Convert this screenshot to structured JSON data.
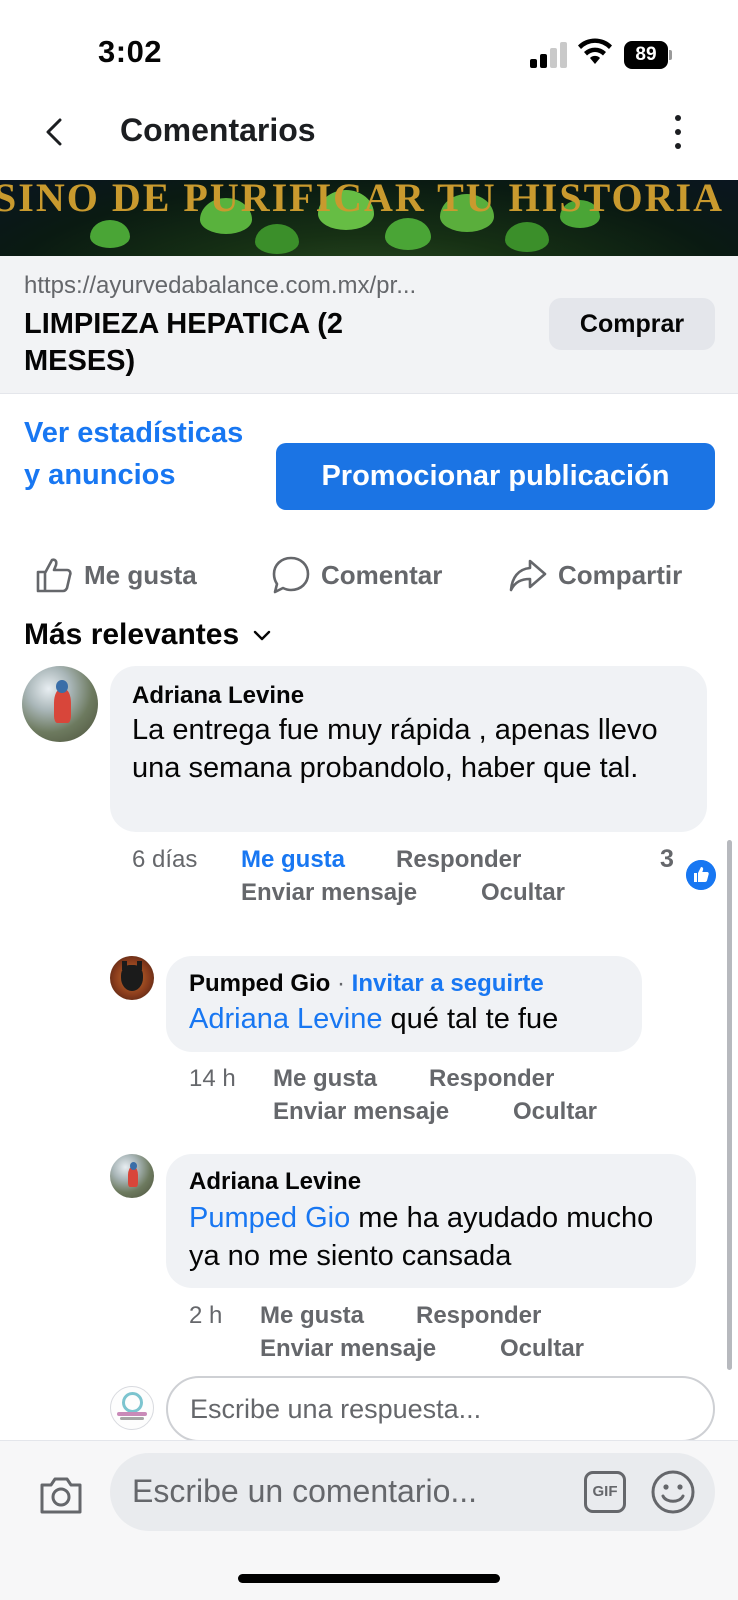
{
  "status_bar": {
    "time": "3:02",
    "battery": "89"
  },
  "header": {
    "title": "Comentarios"
  },
  "banner": {
    "text": "SINO DE PURIFICAR TU HISTORIA"
  },
  "link_card": {
    "url": "https://ayurvedabalance.com.mx/pr...",
    "title": "LIMPIEZA HEPATICA (2 MESES)",
    "button": "Comprar"
  },
  "stats_link": "Ver estadísticas y anuncios",
  "promote_button": "Promocionar publicación",
  "actions": {
    "like": "Me gusta",
    "comment": "Comentar",
    "share": "Compartir"
  },
  "filter": "Más relevantes",
  "comments": [
    {
      "author": "Adriana Levine",
      "text": "La entrega fue muy rápida , apenas llevo una semana probandolo, haber que tal.",
      "time": "6 días",
      "like": "Me gusta",
      "reply": "Responder",
      "message": "Enviar mensaje",
      "hide": "Ocultar",
      "reaction_count": "3"
    },
    {
      "author": "Pumped Gio",
      "invite": "Invitar a seguirte",
      "mention": "Adriana Levine",
      "text": " qué tal te fue",
      "time": "14 h",
      "like": "Me gusta",
      "reply": "Responder",
      "message": "Enviar mensaje",
      "hide": "Ocultar"
    },
    {
      "author": "Adriana Levine",
      "mention": "Pumped Gio",
      "text": " me ha ayudado mucho ya no me siento cansada",
      "time": "2 h",
      "like": "Me gusta",
      "reply": "Responder",
      "message": "Enviar mensaje",
      "hide": "Ocultar"
    }
  ],
  "reply_input": {
    "placeholder": "Escribe una respuesta..."
  },
  "comment_input": {
    "placeholder": "Escribe un comentario...",
    "gif_label": "GIF"
  },
  "colors": {
    "brand_blue": "#1877f2",
    "promote_blue": "#1b74e4",
    "gray_text": "#65676b",
    "bubble": "#f0f2f5"
  },
  "icons": [
    "back-icon",
    "more-icon",
    "like-icon",
    "comment-icon",
    "share-icon",
    "chevron-down-icon",
    "thumbs-up-badge-icon",
    "camera-icon",
    "gif-icon",
    "emoji-icon",
    "signal-icon",
    "wifi-icon",
    "battery-icon"
  ]
}
